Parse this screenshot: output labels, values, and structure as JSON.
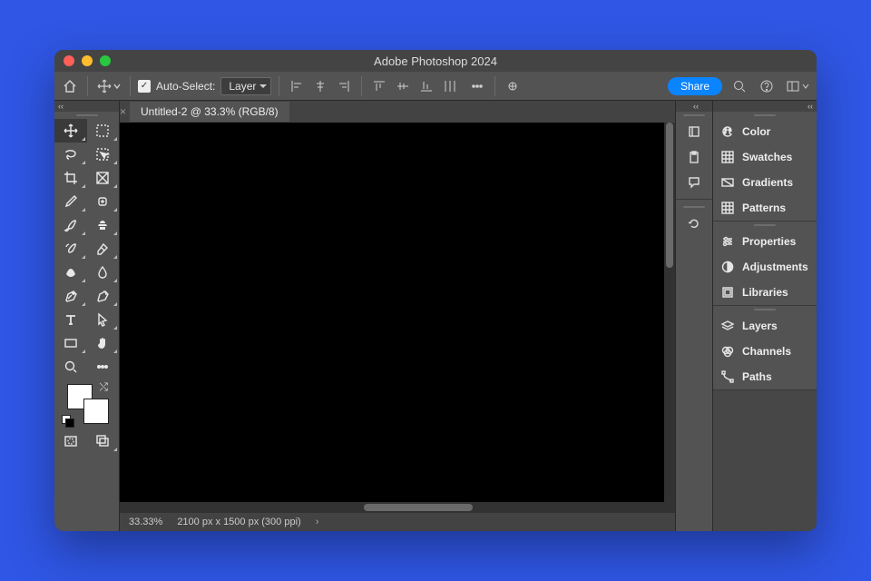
{
  "title": "Adobe Photoshop 2024",
  "options": {
    "auto_select_label": "Auto-Select:",
    "auto_select_checked": true,
    "select_mode": "Layer",
    "share_label": "Share"
  },
  "document": {
    "tab_label": "Untitled-2 @ 33.3% (RGB/8)"
  },
  "status": {
    "zoom": "33.33%",
    "doc_info": "2100 px x 1500 px (300 ppi)"
  },
  "panels": {
    "group1": [
      "Color",
      "Swatches",
      "Gradients",
      "Patterns"
    ],
    "group2": [
      "Properties",
      "Adjustments",
      "Libraries"
    ],
    "group3": [
      "Layers",
      "Channels",
      "Paths"
    ]
  },
  "tools": [
    "move-tool",
    "marquee-tool",
    "lasso-tool",
    "quick-select-tool",
    "crop-tool",
    "frame-tool",
    "eyedropper-tool",
    "healing-brush-tool",
    "brush-tool",
    "clone-stamp-tool",
    "history-brush-tool",
    "eraser-tool",
    "gradient-tool",
    "blur-tool",
    "pen-tool",
    "curvature-pen-tool",
    "type-tool",
    "path-select-tool",
    "rectangle-tool",
    "hand-tool",
    "zoom-tool",
    "edit-toolbar"
  ],
  "narrow_icons": [
    "learn-panel-icon",
    "clipboard-panel-icon",
    "comments-panel-icon",
    "history-panel-icon"
  ]
}
